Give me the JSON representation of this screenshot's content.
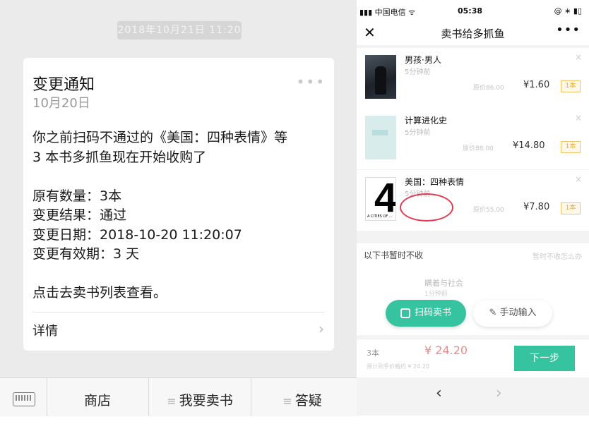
{
  "chat": {
    "timestamp": "2018年10月21日 11:20",
    "card": {
      "title": "变更通知",
      "date": "10月20日",
      "menu_icon": "ellipsis-icon",
      "message_line1": "你之前扫码不通过的《美国：四种表情》等",
      "message_line2": "3 本书多抓鱼现在开始收购了",
      "original_qty": "原有数量：3本",
      "change_result": "变更结果：通过",
      "change_date": "变更日期：2018-10-20 11:20:07",
      "validity": "变更有效期：3 天",
      "cta": "点击去卖书列表查看。",
      "detail_label": "详情",
      "detail_arrow": "›"
    },
    "bottom_menu": {
      "keyboard_icon": "keyboard-icon",
      "items": [
        "商店",
        "我要卖书",
        "答疑"
      ]
    }
  },
  "phone": {
    "status": {
      "carrier": "中国电信",
      "time": "05:38"
    },
    "title": "卖书给多抓鱼",
    "books": [
      {
        "title": "男孩·男人",
        "subtitle": "5分钟前",
        "orig": "原价86.00",
        "price": "¥1.60",
        "tag": "1本"
      },
      {
        "title": "计算进化史",
        "subtitle": "5分钟前",
        "orig": "原价88.00",
        "price": "¥14.80",
        "tag": "1本"
      },
      {
        "title": "美国：四种表情",
        "subtitle": "5分钟前",
        "orig": "原价55.00",
        "price": "¥7.80",
        "tag": "1本"
      }
    ],
    "excluded": {
      "label": "以下书暂时不收",
      "right_text": "暂时不收怎么办",
      "book_title": "瞒着与社会",
      "book_sub": "1分钟前"
    },
    "scan_button": "扫码卖书",
    "manual_button": "手动输入",
    "footer": {
      "count": "3本",
      "total": "¥ 24.20",
      "note": "预计到手价格约 ¥ 24.20",
      "next": "下一步"
    },
    "nav": {
      "back": "‹",
      "forward": "›"
    }
  }
}
